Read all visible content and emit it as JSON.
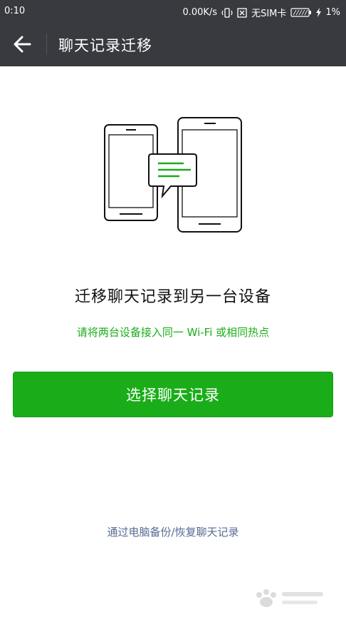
{
  "status_bar": {
    "time": "0:10",
    "network_speed": "0.00K/s",
    "sim_status": "无SIM卡",
    "battery": "1%"
  },
  "toolbar": {
    "title": "聊天记录迁移",
    "back_icon": "back-arrow-icon"
  },
  "main": {
    "illustration_icon": "phones-transfer-chat-icon",
    "headline": "迁移聊天记录到另一台设备",
    "hint": "请将两台设备接入同一 Wi-Fi 或相同热点",
    "primary_button": "选择聊天记录",
    "pc_backup_link": "通过电脑备份/恢复聊天记录"
  },
  "colors": {
    "bar_bg": "#393a3f",
    "accent_green": "#1aad19",
    "link_blue": "#576b95"
  }
}
